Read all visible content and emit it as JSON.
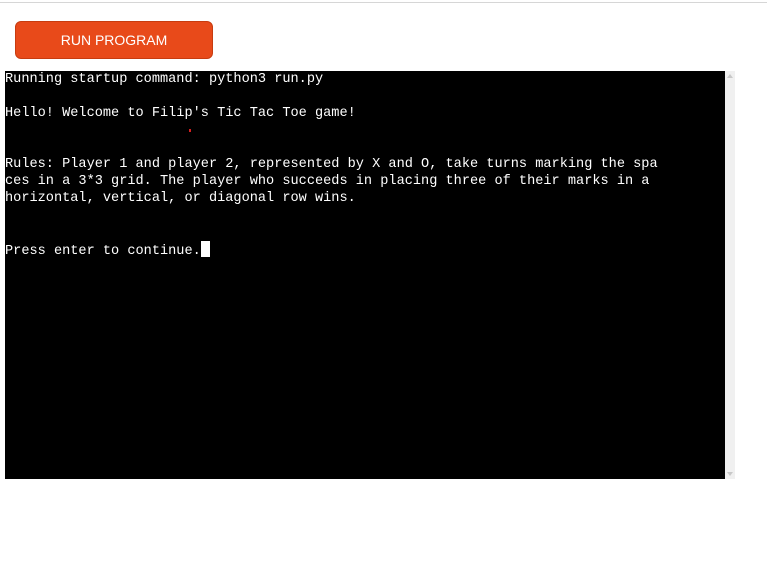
{
  "toolbar": {
    "run_label": "RUN PROGRAM",
    "button_color": "#e84a1a"
  },
  "terminal": {
    "background": "#000000",
    "text_color": "#ffffff",
    "lines": [
      "Running startup command: python3 run.py",
      "",
      "Hello! Welcome to Filip's Tic Tac Toe game!",
      "",
      "",
      "Rules: Player 1 and player 2, represented by X and O, take turns marking the spa",
      "ces in a 3*3 grid. The player who succeeds in placing three of their marks in a",
      "horizontal, vertical, or diagonal row wins.",
      "",
      "",
      "Press enter to continue."
    ]
  }
}
